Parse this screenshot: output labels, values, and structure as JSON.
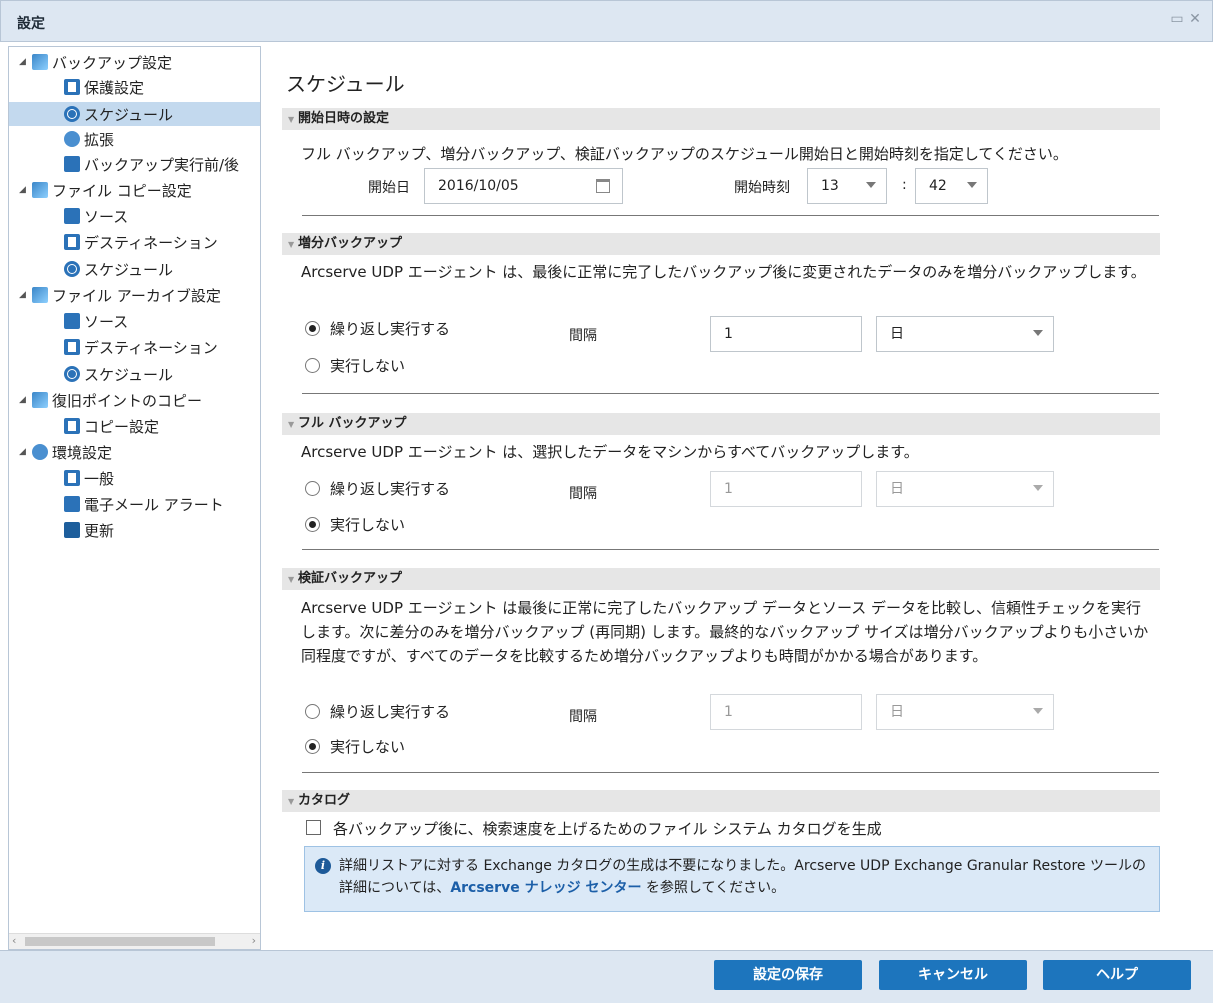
{
  "window": {
    "title": "設定"
  },
  "tree": [
    {
      "label": "バックアップ設定",
      "icon": "backup-category-icon"
    },
    {
      "label": "保護設定",
      "icon": "document-icon"
    },
    {
      "label": "スケジュール",
      "icon": "clock-icon"
    },
    {
      "label": "拡張",
      "icon": "gear-icon"
    },
    {
      "label": "バックアップ実行前/後",
      "icon": "wrench-icon"
    },
    {
      "label": "ファイル コピー設定",
      "icon": "file-copy-category-icon"
    },
    {
      "label": "ソース",
      "icon": "tree-icon"
    },
    {
      "label": "デスティネーション",
      "icon": "document-icon"
    },
    {
      "label": "スケジュール",
      "icon": "clock-icon"
    },
    {
      "label": "ファイル アーカイブ設定",
      "icon": "file-archive-category-icon"
    },
    {
      "label": "ソース",
      "icon": "tree-icon"
    },
    {
      "label": "デスティネーション",
      "icon": "document-icon"
    },
    {
      "label": "スケジュール",
      "icon": "clock-icon"
    },
    {
      "label": "復旧ポイントのコピー",
      "icon": "recovery-copy-category-icon"
    },
    {
      "label": "コピー設定",
      "icon": "document-icon"
    },
    {
      "label": "環境設定",
      "icon": "preferences-category-icon"
    },
    {
      "label": "一般",
      "icon": "general-icon"
    },
    {
      "label": "電子メール アラート",
      "icon": "mail-icon"
    },
    {
      "label": "更新",
      "icon": "update-icon"
    }
  ],
  "main": {
    "title": "スケジュール",
    "start": {
      "header": "開始日時の設定",
      "description": "フル バックアップ、増分バックアップ、検証バックアップのスケジュール開始日と開始時刻を指定してください。",
      "date_label": "開始日",
      "date_value": "2016/10/05",
      "time_label": "開始時刻",
      "hour": "13",
      "colon": ":",
      "minute": "42"
    },
    "incremental": {
      "header": "増分バックアップ",
      "description": "Arcserve UDP エージェント は、最後に正常に完了したバックアップ後に変更されたデータのみを増分バックアップします。",
      "repeat_label": "繰り返し実行する",
      "never_label": "実行しない",
      "interval_label": "間隔",
      "interval_value": "1",
      "unit": "日",
      "selected": "repeat"
    },
    "full": {
      "header": "フル バックアップ",
      "description": "Arcserve UDP エージェント は、選択したデータをマシンからすべてバックアップします。",
      "repeat_label": "繰り返し実行する",
      "never_label": "実行しない",
      "interval_label": "間隔",
      "interval_value": "1",
      "unit": "日",
      "selected": "never"
    },
    "verify": {
      "header": "検証バックアップ",
      "description": "Arcserve UDP エージェント は最後に正常に完了したバックアップ データとソース データを比較し、信頼性チェックを実行します。次に差分のみを増分バックアップ (再同期) します。最終的なバックアップ サイズは増分バックアップよりも小さいか同程度ですが、すべてのデータを比較するため増分バックアップよりも時間がかかる場合があります。",
      "repeat_label": "繰り返し実行する",
      "never_label": "実行しない",
      "interval_label": "間隔",
      "interval_value": "1",
      "unit": "日",
      "selected": "never"
    },
    "catalog": {
      "header": "カタログ",
      "checkbox_label": "各バックアップ後に、検索速度を上げるためのファイル システム カタログを生成",
      "checked": false,
      "info_text_1": "詳細リストアに対する Exchange カタログの生成は不要になりました。Arcserve UDP Exchange Granular Restore ツールの詳細については、",
      "info_link": "Arcserve ナレッジ センター",
      "info_text_2": " を参照してください。"
    }
  },
  "footer": {
    "save_label": "設定の保存",
    "cancel_label": "キャンセル",
    "help_label": "ヘルプ"
  }
}
